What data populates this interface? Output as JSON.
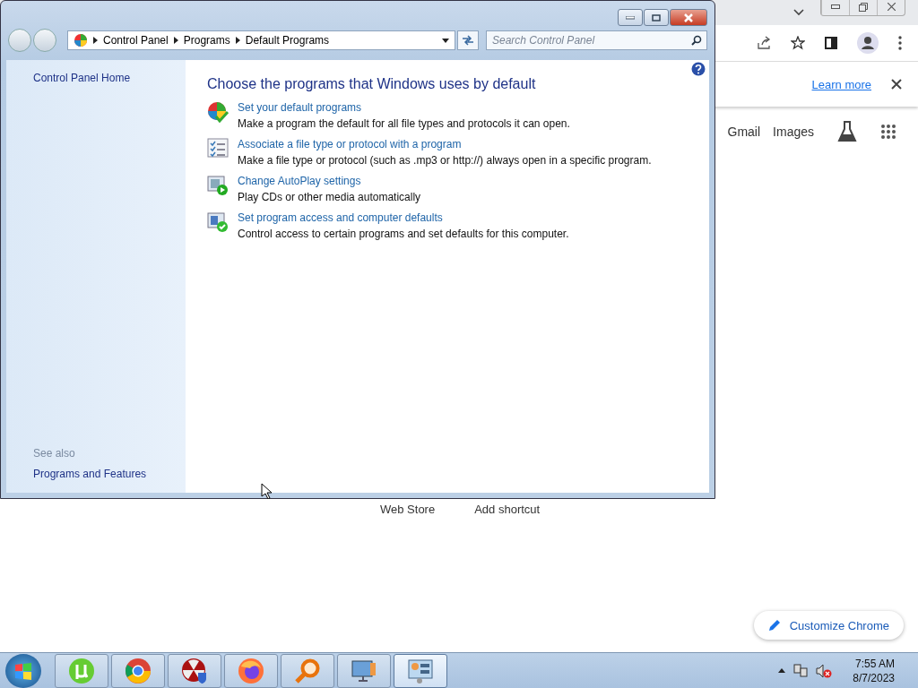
{
  "browser": {
    "infobar_link": "Learn more",
    "header_links": [
      "Gmail",
      "Images"
    ],
    "shortcuts": [
      "Web Store",
      "Add shortcut"
    ],
    "customize_button": "Customize Chrome"
  },
  "window": {
    "breadcrumb": [
      "Control Panel",
      "Programs",
      "Default Programs"
    ],
    "search": {
      "placeholder": "Search Control Panel"
    },
    "sidebar": {
      "home": "Control Panel Home",
      "see_also_heading": "See also",
      "see_also": [
        "Programs and Features"
      ]
    },
    "heading": "Choose the programs that Windows uses by default",
    "tasks": [
      {
        "kind": "defaults",
        "link": "Set your default programs",
        "description": "Make a program the default for all file types and protocols it can open."
      },
      {
        "kind": "associate",
        "link": "Associate a file type or protocol with a program",
        "description": "Make a file type or protocol (such as .mp3 or http://) always open in a specific program."
      },
      {
        "kind": "autoplay",
        "link": "Change AutoPlay settings",
        "description": "Play CDs or other media automatically"
      },
      {
        "kind": "access",
        "link": "Set program access and computer defaults",
        "description": "Control access to certain programs and set defaults for this computer."
      }
    ]
  },
  "taskbar": {
    "apps": [
      {
        "kind": "utorrent",
        "selected": false
      },
      {
        "kind": "chrome",
        "selected": false
      },
      {
        "kind": "shield",
        "selected": false
      },
      {
        "kind": "firefox",
        "selected": false
      },
      {
        "kind": "magnifier",
        "selected": false
      },
      {
        "kind": "monitor",
        "selected": false
      },
      {
        "kind": "controlpanel",
        "selected": true
      }
    ],
    "clock": {
      "time": "7:55 AM",
      "date": "8/7/2023"
    }
  }
}
